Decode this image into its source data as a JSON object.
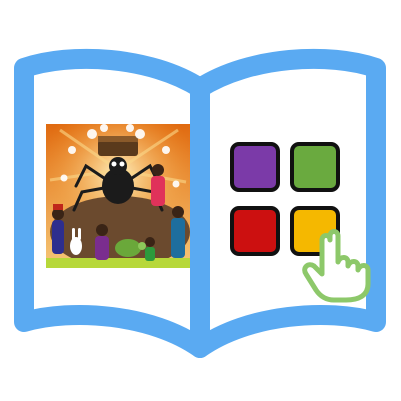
{
  "icon": {
    "book_color": "#5aaaf2",
    "book_fill": "#ffffff",
    "tile_border": "#111111",
    "tiles": [
      {
        "name": "purple",
        "color": "#7b3aa8"
      },
      {
        "name": "green",
        "color": "#6aaa3f"
      },
      {
        "name": "red",
        "color": "#cc1010"
      },
      {
        "name": "yellow",
        "color": "#f5b800"
      }
    ],
    "hand_outline": "#8dc86a",
    "hand_fill": "#ffffff",
    "illustration": {
      "sky_top": "#e06a10",
      "sky_bottom": "#f6c878",
      "ground": "#6b4a2e",
      "grass": "#b7d83a",
      "character": "spider-and-villagers"
    }
  }
}
